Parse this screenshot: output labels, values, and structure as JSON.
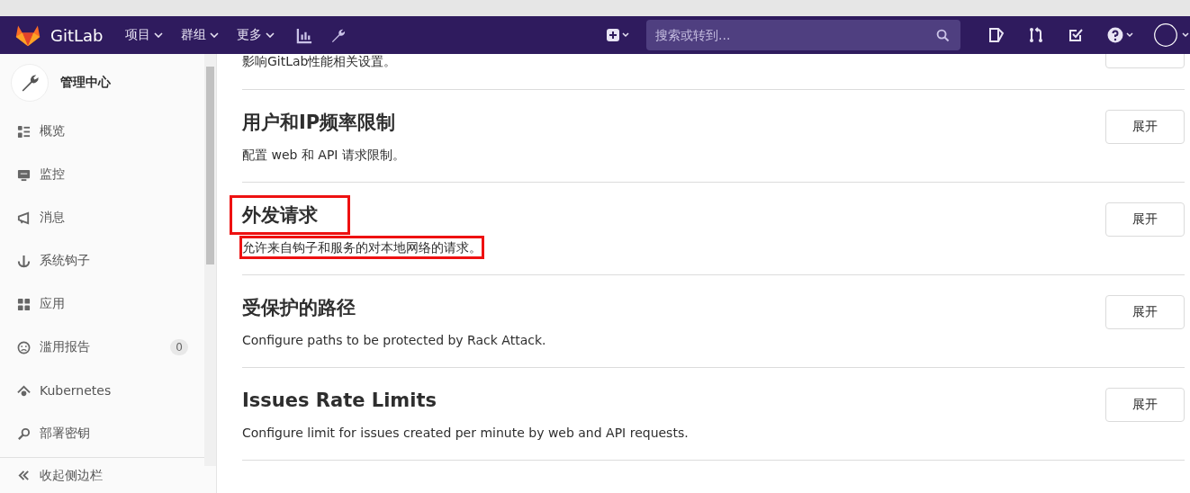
{
  "header": {
    "brand": "GitLab",
    "menus": [
      {
        "label": "项目"
      },
      {
        "label": "群组"
      },
      {
        "label": "更多"
      }
    ],
    "search": {
      "placeholder": "搜索或转到..."
    }
  },
  "sidebar": {
    "title": "管理中心",
    "items": [
      {
        "label": "概览"
      },
      {
        "label": "监控"
      },
      {
        "label": "消息"
      },
      {
        "label": "系统钩子"
      },
      {
        "label": "应用"
      },
      {
        "label": "滥用报告",
        "count": "0"
      },
      {
        "label": "Kubernetes"
      },
      {
        "label": "部署密钥"
      }
    ],
    "collapse": "收起侧边栏"
  },
  "sections": [
    {
      "description": "影响GitLab性能相关设置。",
      "highlighted": false
    },
    {
      "title": "用户和IP频率限制",
      "description": "配置 web 和 API 请求限制。",
      "button": "展开",
      "highlighted": false
    },
    {
      "title": "外发请求",
      "description": "允许来自钩子和服务的对本地网络的请求。",
      "button": "展开",
      "highlighted": true
    },
    {
      "title": "受保护的路径",
      "description": "Configure paths to be protected by Rack Attack.",
      "button": "展开",
      "highlighted": false
    },
    {
      "title": "Issues Rate Limits",
      "description": "Configure limit for issues created per minute by web and API requests.",
      "button": "展开",
      "highlighted": false
    }
  ]
}
